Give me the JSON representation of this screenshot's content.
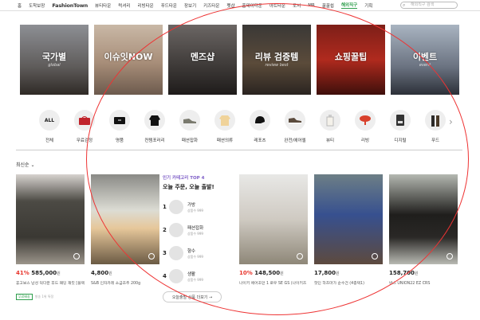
{
  "topnav": {
    "items": [
      "홈",
      "도착보장",
      "FashionTown",
      "뷰티타운",
      "럭셔리",
      "리빙타운",
      "푸드타운",
      "장보기",
      "키즈타운",
      "펫샵",
      "홈데이타운",
      "아트타운",
      "도서",
      "MR",
      "꿀꿀쉽",
      "해외직구",
      "기획"
    ],
    "active_index": 15,
    "search_placeholder": "해외직구 검색"
  },
  "banners": [
    {
      "title": "국가별",
      "sub": "global"
    },
    {
      "title": "이슈잇NOW",
      "sub": ""
    },
    {
      "title": "멘즈샵",
      "sub": ""
    },
    {
      "title": "리뷰 검증템",
      "sub": "review best"
    },
    {
      "title": "쇼핑꿀팁",
      "sub": ""
    },
    {
      "title": "이벤트",
      "sub": "event"
    }
  ],
  "categories": [
    {
      "label": "전체",
      "icon": "ALL"
    },
    {
      "label": "무료검정",
      "icon": "red-bag-icon"
    },
    {
      "label": "명품",
      "icon": "black-bag-icon"
    },
    {
      "label": "컨템포러리",
      "icon": "jacket-icon"
    },
    {
      "label": "패션잡화",
      "icon": "sneaker-icon"
    },
    {
      "label": "패션의류",
      "icon": "shirt-icon"
    },
    {
      "label": "레포츠",
      "icon": "helmet-icon"
    },
    {
      "label": "완전/에어엘",
      "icon": "shoe-icon"
    },
    {
      "label": "뷰티",
      "icon": "perfume-icon"
    },
    {
      "label": "리빙",
      "icon": "lamp-icon"
    },
    {
      "label": "디지털",
      "icon": "coffee-machine-icon"
    },
    {
      "label": "푸드",
      "icon": "bottle-icon"
    }
  ],
  "sort_label": "최신순",
  "products": [
    {
      "pct": "41%",
      "price": "585,000",
      "won": "원",
      "desc": "휴고보스 남성 덕다운 후드 패딩 재킷 [블랙]",
      "badge": "무료배송",
      "extra": "발송 1위 특정"
    },
    {
      "pct": "",
      "price": "4,800",
      "won": "원",
      "desc": "S&B 인자카레 소금조추 200g",
      "badge": "",
      "extra": ""
    },
    {
      "pct": "10%",
      "price": "148,500",
      "won": "원",
      "desc": "나이키 에어조던 1 로우 SE GS (나이키즈 블랙메탈릭골드)",
      "badge": "",
      "extra": ""
    },
    {
      "pct": "",
      "price": "17,800",
      "won": "원",
      "desc": "핫딘 하츠마가 순수건 (4종택1)",
      "badge": "",
      "extra": ""
    },
    {
      "pct": "",
      "price": "158,700",
      "won": "원",
      "desc": "반스 UNION22 EZ CRS",
      "badge": "",
      "extra": ""
    }
  ],
  "top4": {
    "title": "인기 카테고리 TOP 4",
    "headline": "오늘 주문, 오늘 출발!",
    "ranks": [
      {
        "num": "1",
        "name": "가방",
        "small": "상품수 999"
      },
      {
        "num": "2",
        "name": "패션잡화",
        "small": "상품수 999"
      },
      {
        "num": "3",
        "name": "향수",
        "small": "상품수 999"
      },
      {
        "num": "4",
        "name": "생활",
        "small": "상품수 999"
      }
    ],
    "more_label": "오늘출발 상품 더보기 →"
  },
  "colors": {
    "accent_green": "#2e9e4c",
    "sale_red": "#e8352c",
    "annotation_red": "#ee3333"
  }
}
